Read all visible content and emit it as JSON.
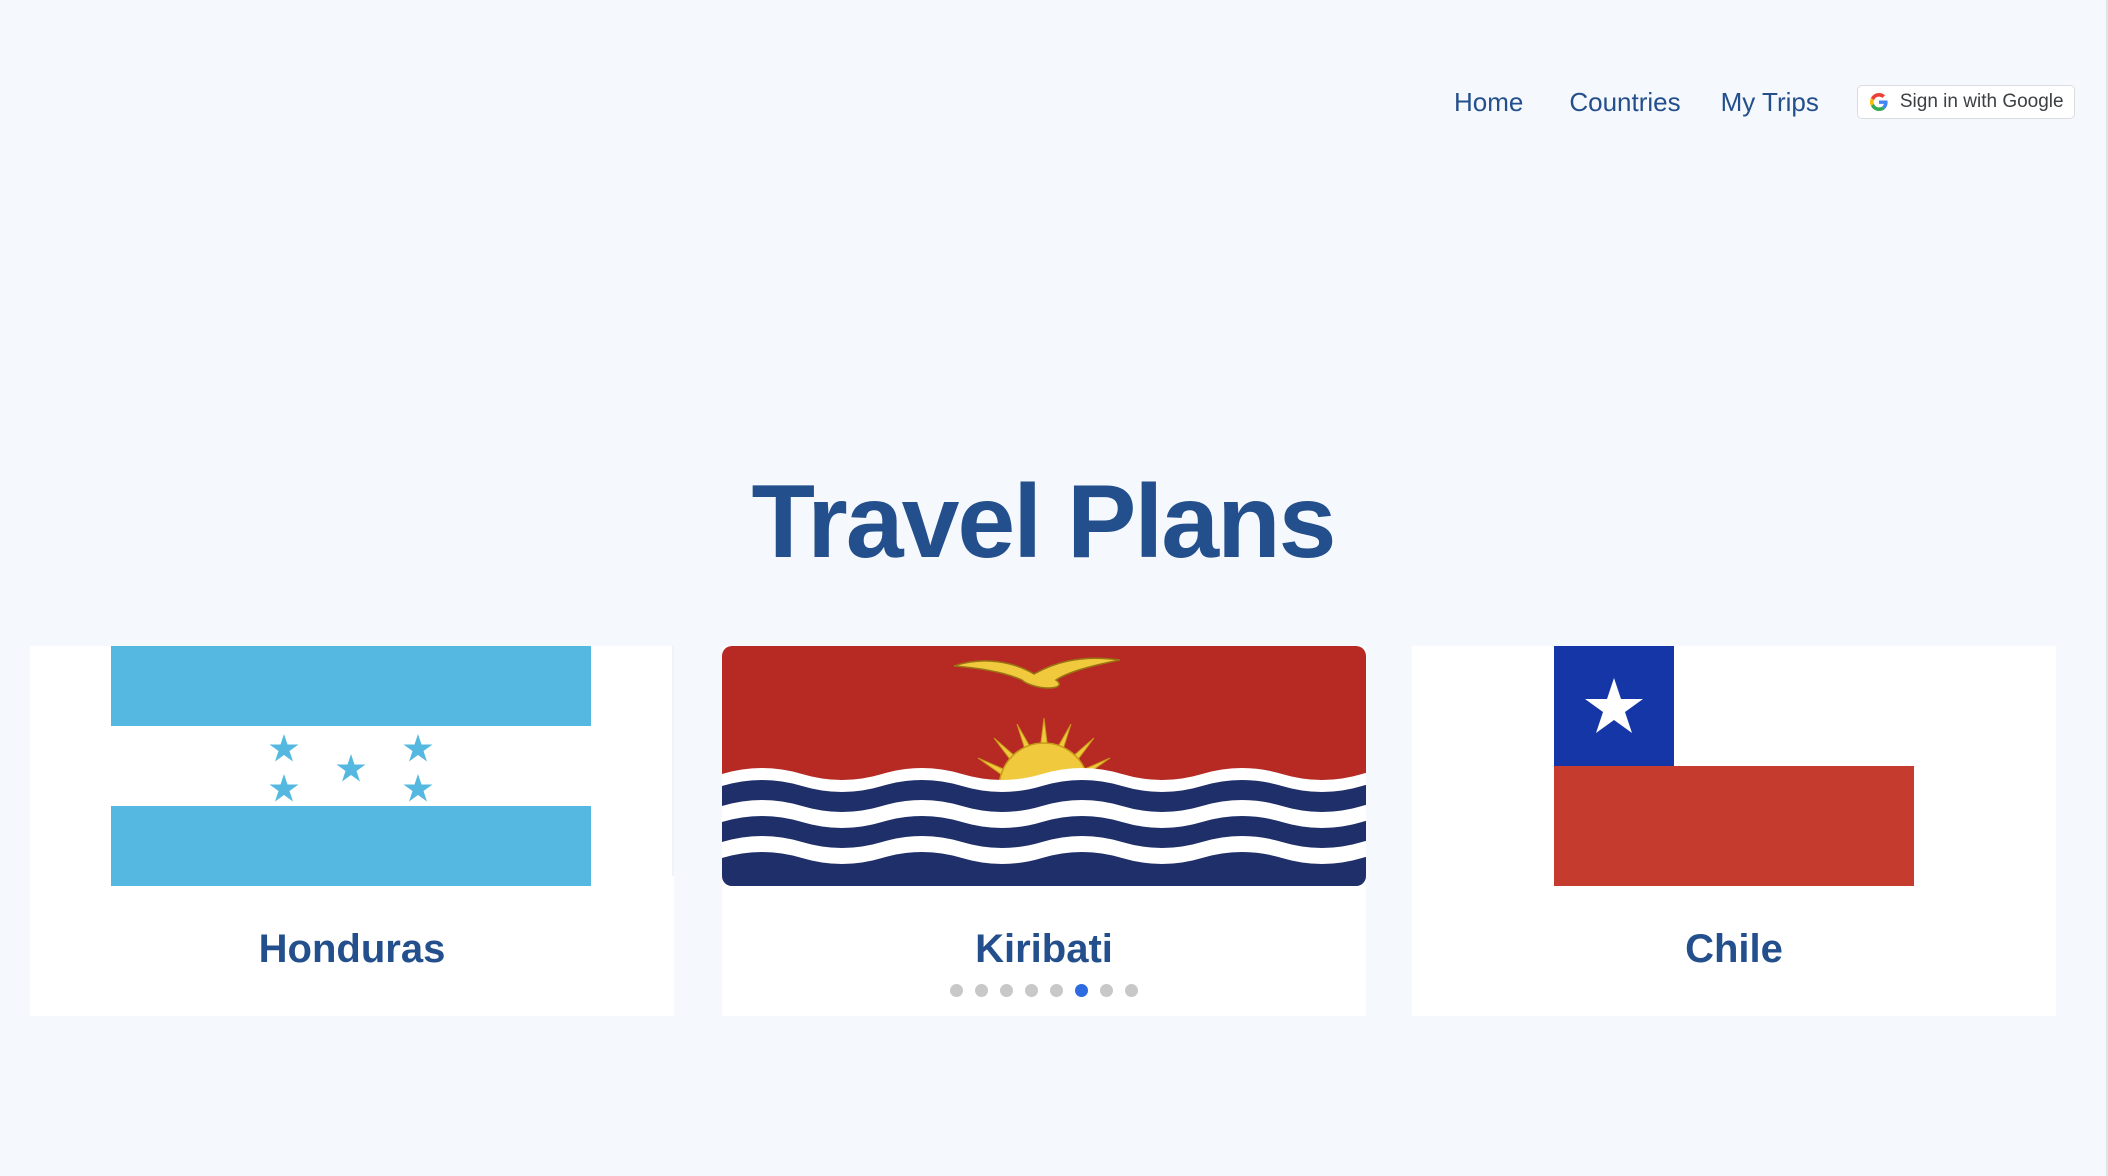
{
  "nav": {
    "home": "Home",
    "countries": "Countries",
    "my_trips": "My Trips",
    "google_signin": "Sign in with Google"
  },
  "page": {
    "title": "Travel Plans"
  },
  "carousel": {
    "cards": [
      {
        "name": "Honduras",
        "flag": "honduras-flag"
      },
      {
        "name": "Kiribati",
        "flag": "kiribati-flag"
      },
      {
        "name": "Chile",
        "flag": "chile-flag"
      }
    ],
    "total_slides": 8,
    "active_index": 5
  },
  "colors": {
    "background": "#f5f8fc",
    "text_primary": "#234f8c",
    "dot_inactive": "#c8c8c8",
    "dot_active": "#2f6be0",
    "honduras_blue": "#55b8e0",
    "kiribati_red": "#b72a23",
    "kiribati_navy": "#1f2f6a",
    "kiribati_gold": "#f0c93c",
    "chile_blue": "#1436a6",
    "chile_red": "#c53b2e"
  }
}
